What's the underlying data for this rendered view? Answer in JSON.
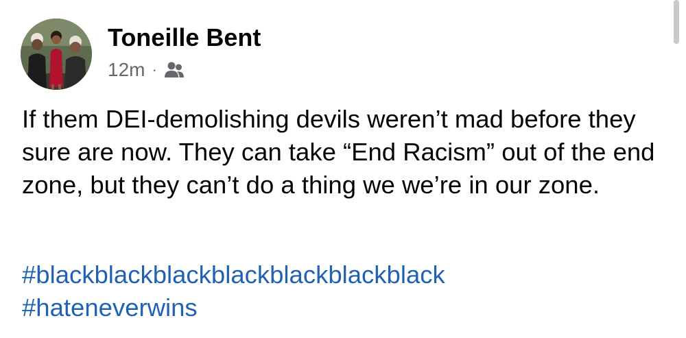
{
  "post": {
    "author": {
      "name": "Toneille Bent",
      "avatar_icon": "profile-photo-group-of-three"
    },
    "meta": {
      "time": "12m",
      "separator": "·",
      "audience_icon": "friends-icon"
    },
    "body_text": "If them DEI-demolishing devils weren’t mad before they sure are now. They can take “End Racism” out of the end zone, but they can’t do a thing we we’re in our zone.",
    "hashtags": [
      "#blackblackblackblackblackblackblack",
      "#hateneverwins"
    ]
  },
  "colors": {
    "text": "#050505",
    "meta_text": "#65676b",
    "hashtag": "#1f62b4",
    "scrollbar": "#c9c9cc"
  }
}
